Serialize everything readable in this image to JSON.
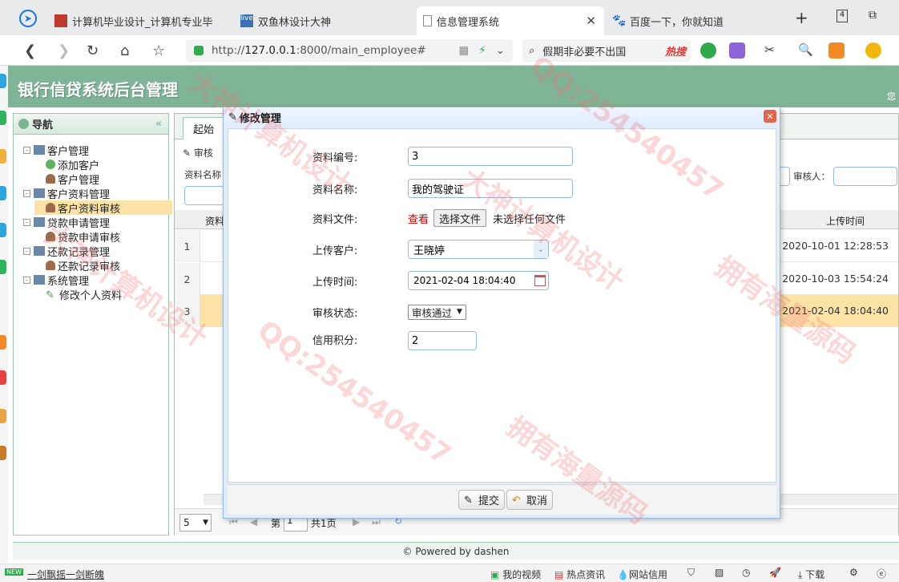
{
  "browser": {
    "tabs": [
      {
        "title": "计算机毕业设计_计算机专业毕"
      },
      {
        "title": "双鱼林设计大神"
      },
      {
        "title": "信息管理系统"
      },
      {
        "title": "百度一下，你就知道"
      }
    ],
    "tab_count": "4",
    "url_scheme": "http://",
    "url_host": "127.0.0.1",
    "url_rest": ":8000/main_employee#",
    "search_text": "假期非必要不出国",
    "search_hot": "热搜"
  },
  "app": {
    "title": "银行信贷系统后台管理",
    "header_right": "您",
    "nav_title": "导航",
    "nav_collapse": "«",
    "tree": [
      {
        "label": "客户管理",
        "level": 1
      },
      {
        "label": "添加客户",
        "level": 2
      },
      {
        "label": "客户管理",
        "level": 2
      },
      {
        "label": "客户资料管理",
        "level": 1
      },
      {
        "label": "客户资料审核",
        "level": 2,
        "selected": true
      },
      {
        "label": "贷款申请管理",
        "level": 1
      },
      {
        "label": "贷款申请审核",
        "level": 2
      },
      {
        "label": "还款记录管理",
        "level": 1
      },
      {
        "label": "还款记录审核",
        "level": 2
      },
      {
        "label": "系统管理",
        "level": 1
      },
      {
        "label": "修改个人资料",
        "level": 2
      }
    ],
    "main_tab": "起始",
    "toolbar_btn": "审核",
    "filter_label": "资料名称",
    "filter_reviewer": "审核人：",
    "grid_col_first": "资料",
    "grid_col_upload_time": "上传时间",
    "rows": [
      {
        "no": "1",
        "time": "2020-10-01 12:28:53"
      },
      {
        "no": "2",
        "time": "2020-10-03 15:54:24"
      },
      {
        "no": "3",
        "time": "2021-02-04 18:04:40"
      }
    ],
    "pager": {
      "size": "5",
      "page_label": "第",
      "page": "1",
      "total": "共1页"
    },
    "footer": "© Powered by dashen"
  },
  "modal": {
    "title": "修改管理",
    "fields": {
      "id_label": "资料编号:",
      "id_value": "3",
      "name_label": "资料名称:",
      "name_value": "我的驾驶证",
      "file_label": "资料文件:",
      "file_view": "查看",
      "file_choose": "选择文件",
      "file_none": "未选择任何文件",
      "customer_label": "上传客户:",
      "customer_value": "王晓婷",
      "time_label": "上传时间:",
      "time_value": "2021-02-04 18:04:40",
      "status_label": "审核状态:",
      "status_value": "审核通过",
      "credit_label": "信用积分:",
      "credit_value": "2"
    },
    "submit": "提交",
    "cancel": "取消"
  },
  "statusbar": {
    "badge": "NEW",
    "left_text": "一剑飘摇一剑断魄",
    "items": [
      "我的视频",
      "热点资讯",
      "网站信用",
      "下载"
    ]
  },
  "watermark": [
    "QQ:254540457",
    "大神计算机设计",
    "拥有海量源码"
  ]
}
